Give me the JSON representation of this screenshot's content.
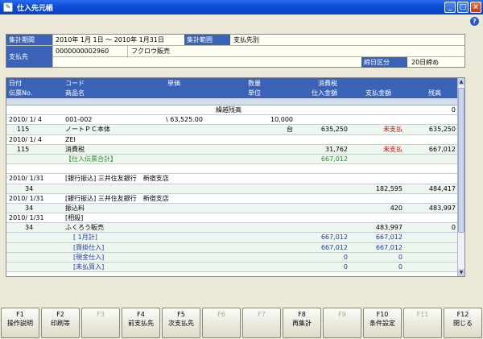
{
  "window": {
    "title": "仕入先元帳"
  },
  "header": {
    "period_label": "集計期間",
    "period_value": "2010年 1月 1日 ～ 2010年 1月31日",
    "range_label": "集計範囲",
    "range_value": "支払先別",
    "supplier_label": "支払先",
    "supplier_code": "0000000002960",
    "supplier_name": "フクロウ販売",
    "closing_label": "締日区分",
    "closing_value": "20日締め"
  },
  "grid": {
    "headers": {
      "date": "日付",
      "slip": "伝票No.",
      "code": "コード",
      "product": "商品名",
      "price": "単価",
      "qty": "数量",
      "unit": "単位",
      "tax": "消費税",
      "purchase": "仕入金額",
      "payment": "支払金額",
      "balance": "残高"
    },
    "rows": [
      {
        "date": "",
        "code": "繰越残高",
        "price": "",
        "qty": "",
        "tax": "",
        "pay": "",
        "bal": "0",
        "carry": true
      },
      {
        "date": "2010/ 1/ 4",
        "code": "001-002",
        "price": "\\ 63,525.00",
        "qty": "10,000",
        "tax": "",
        "pay": "",
        "bal": ""
      },
      {
        "date": "115",
        "code": "ノートＰＣ本体",
        "price": "",
        "qty": "台",
        "tax": "635,250",
        "pay": "未支払",
        "bal": "635,250",
        "payred": true
      },
      {
        "date": "2010/ 1/ 4",
        "code": "ZEI",
        "price": "",
        "qty": "",
        "tax": "",
        "pay": "",
        "bal": ""
      },
      {
        "date": "115",
        "code": "消費税",
        "price": "",
        "qty": "",
        "tax": "31,762",
        "pay": "未支払",
        "bal": "667,012",
        "payred": true
      },
      {
        "date": "",
        "code": "【仕入伝票合計】",
        "price": "",
        "qty": "",
        "tax": "667,012",
        "pay": "",
        "bal": "",
        "green": true
      },
      {
        "date": "",
        "code": "",
        "price": "",
        "qty": "",
        "tax": "",
        "pay": "",
        "bal": ""
      },
      {
        "date": "2010/ 1/31",
        "code": "[銀行振込] 三井住友銀行　新宿支店",
        "price": "",
        "qty": "",
        "tax": "",
        "pay": "",
        "bal": ""
      },
      {
        "date": "34",
        "code": "",
        "price": "",
        "qty": "",
        "tax": "",
        "pay": "182,595",
        "bal": "484,417"
      },
      {
        "date": "2010/ 1/31",
        "code": "[銀行振込] 三井住友銀行　新宿支店",
        "price": "",
        "qty": "",
        "tax": "",
        "pay": "",
        "bal": ""
      },
      {
        "date": "34",
        "code": "振込料",
        "price": "",
        "qty": "",
        "tax": "",
        "pay": "420",
        "bal": "483,997"
      },
      {
        "date": "2010/ 1/31",
        "code": "[相殺]",
        "price": "",
        "qty": "",
        "tax": "",
        "pay": "",
        "bal": ""
      },
      {
        "date": "34",
        "code": "ふくろう販売",
        "price": "",
        "qty": "",
        "tax": "",
        "pay": "483,997",
        "bal": "0"
      },
      {
        "date": "",
        "code": "[ 1月計]",
        "price": "",
        "qty": "",
        "tax": "667,012",
        "pay": "667,012",
        "bal": "",
        "blue": true
      },
      {
        "date": "",
        "code": "[買掛仕入]",
        "price": "",
        "qty": "",
        "tax": "667,012",
        "pay": "667,012",
        "bal": "",
        "blue": true
      },
      {
        "date": "",
        "code": "[現金仕入]",
        "price": "",
        "qty": "",
        "tax": "0",
        "pay": "0",
        "bal": "",
        "blue": true
      },
      {
        "date": "",
        "code": "[未払買入]",
        "price": "",
        "qty": "",
        "tax": "0",
        "pay": "0",
        "bal": "",
        "blue": true
      }
    ]
  },
  "fkeys": [
    {
      "key": "F1",
      "label": "操作説明",
      "enabled": true
    },
    {
      "key": "F2",
      "label": "印刷等",
      "enabled": true
    },
    {
      "key": "F3",
      "label": "",
      "enabled": false
    },
    {
      "key": "F4",
      "label": "前支払先",
      "enabled": true
    },
    {
      "key": "F5",
      "label": "次支払先",
      "enabled": true
    },
    {
      "key": "F6",
      "label": "",
      "enabled": false
    },
    {
      "key": "F7",
      "label": "",
      "enabled": false
    },
    {
      "key": "F8",
      "label": "再集計",
      "enabled": true
    },
    {
      "key": "F9",
      "label": "",
      "enabled": false
    },
    {
      "key": "F10",
      "label": "条件設定",
      "enabled": true
    },
    {
      "key": "F11",
      "label": "",
      "enabled": false
    },
    {
      "key": "F12",
      "label": "閉じる",
      "enabled": true
    }
  ],
  "colors": {
    "titlebar": "#0a4fd6",
    "header_label": "#3a63b8",
    "warning": "#d00000",
    "total": "#1c3aa8",
    "subtotal": "#2c8a2c"
  }
}
